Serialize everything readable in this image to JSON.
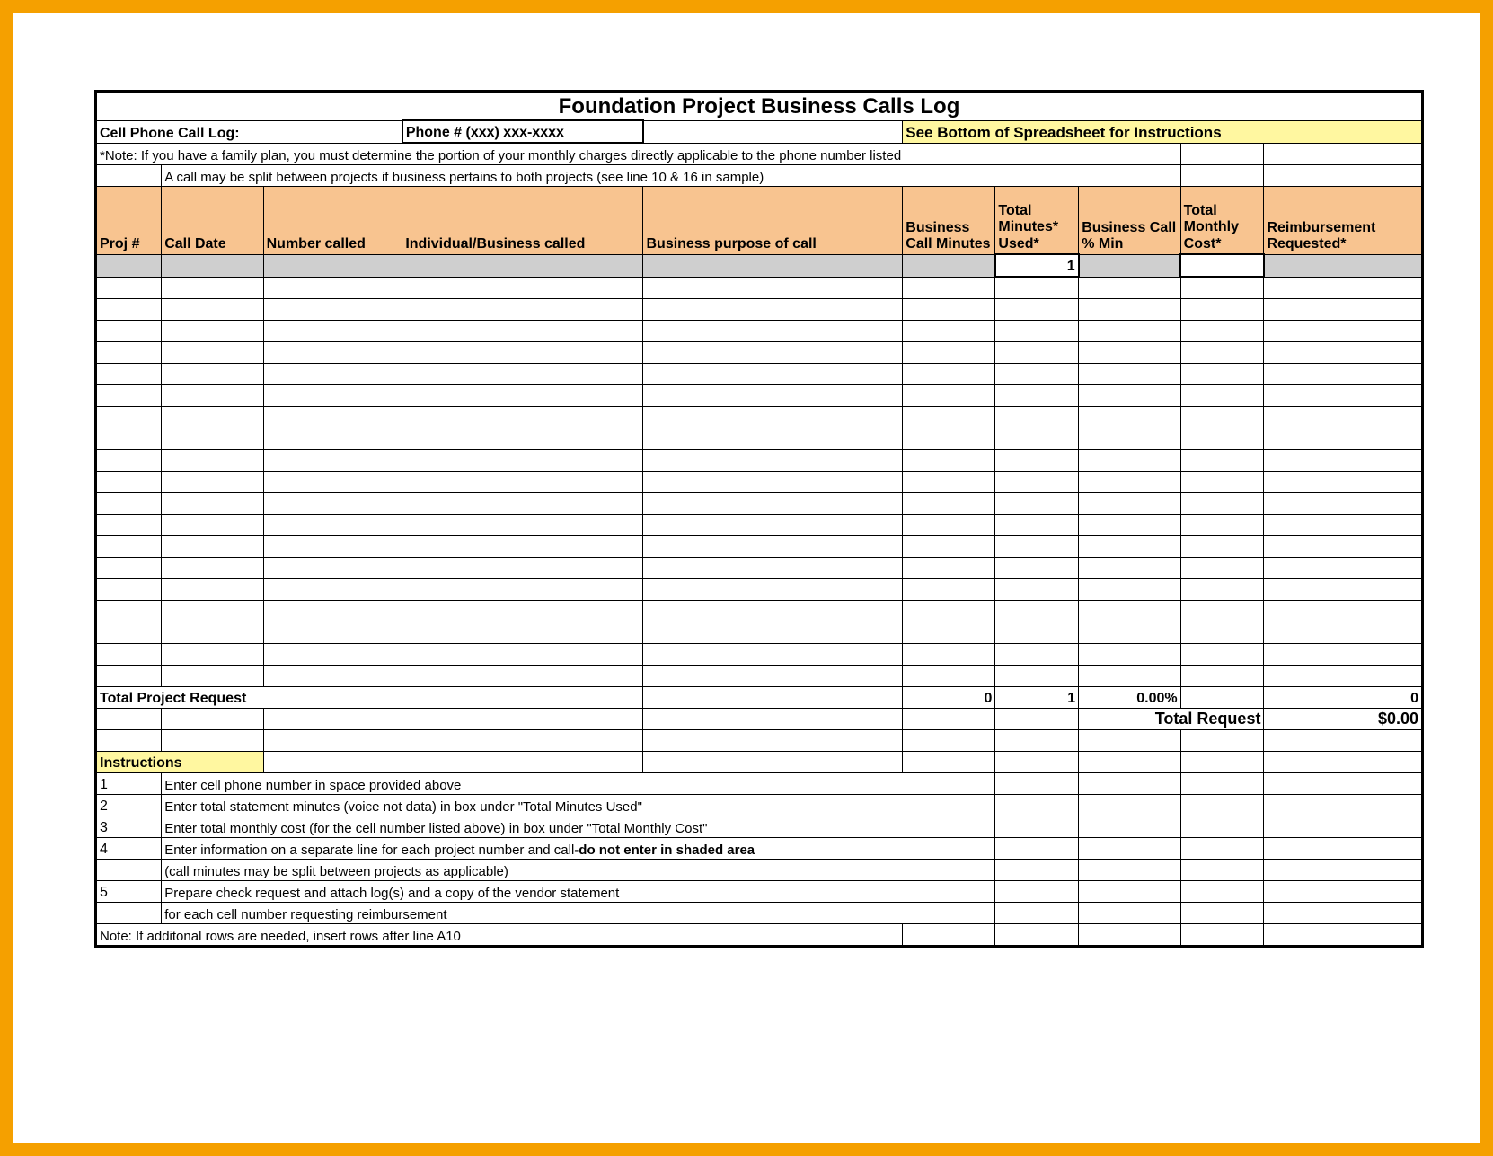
{
  "title": "Foundation Project Business Calls Log",
  "cell_phone_label": "Cell Phone Call Log:",
  "phone_number_label": "Phone # (xxx) xxx-xxxx",
  "instructions_banner": "See Bottom of Spreadsheet for Instructions",
  "note1": "*Note:  If you have a family plan, you must determine the portion of your monthly charges directly applicable to the phone number listed",
  "note2": "A call may be split between projects if business pertains to both projects (see line 10 & 16 in sample)",
  "headers": {
    "proj": "Proj #",
    "call_date": "Call Date",
    "number_called": "Number called",
    "individual": "Individual/Business called",
    "purpose": "Business purpose of call",
    "bus_call_min": "Business Call Minutes",
    "total_min_used": "Total Minutes* Used*",
    "bus_call_pct": "Business Call % Min",
    "total_monthly_cost": "Total Monthly Cost*",
    "reimbursement": "Reimbursement Requested*"
  },
  "initial_total_minutes": "1",
  "totals": {
    "label": "Total Project Request",
    "bus_minutes": "0",
    "total_minutes": "1",
    "pct": "0.00%",
    "reimbursement_total": "0",
    "total_request_label": "Total Request",
    "total_request_value": "$0.00"
  },
  "instructions_header": "Instructions",
  "instructions": [
    {
      "n": "1",
      "text": "Enter cell phone number in space provided above"
    },
    {
      "n": "2",
      "text": "Enter total statement minutes (voice not data) in box under \"Total Minutes Used\""
    },
    {
      "n": "3",
      "text": "Enter total monthly cost (for the cell number listed above) in box under \"Total Monthly Cost\""
    },
    {
      "n": "4",
      "text_pre": "Enter information on a separate line for each project number and call-",
      "text_bold": "do not enter in shaded area"
    },
    {
      "n": "",
      "text": "(call minutes may be split between projects as applicable)"
    },
    {
      "n": "5",
      "text": "Prepare check request and attach log(s) and a copy of the vendor statement"
    },
    {
      "n": "",
      "text": "for each cell number requesting reimbursement"
    }
  ],
  "final_note": "Note: If additonal rows are needed, insert rows after line A10"
}
